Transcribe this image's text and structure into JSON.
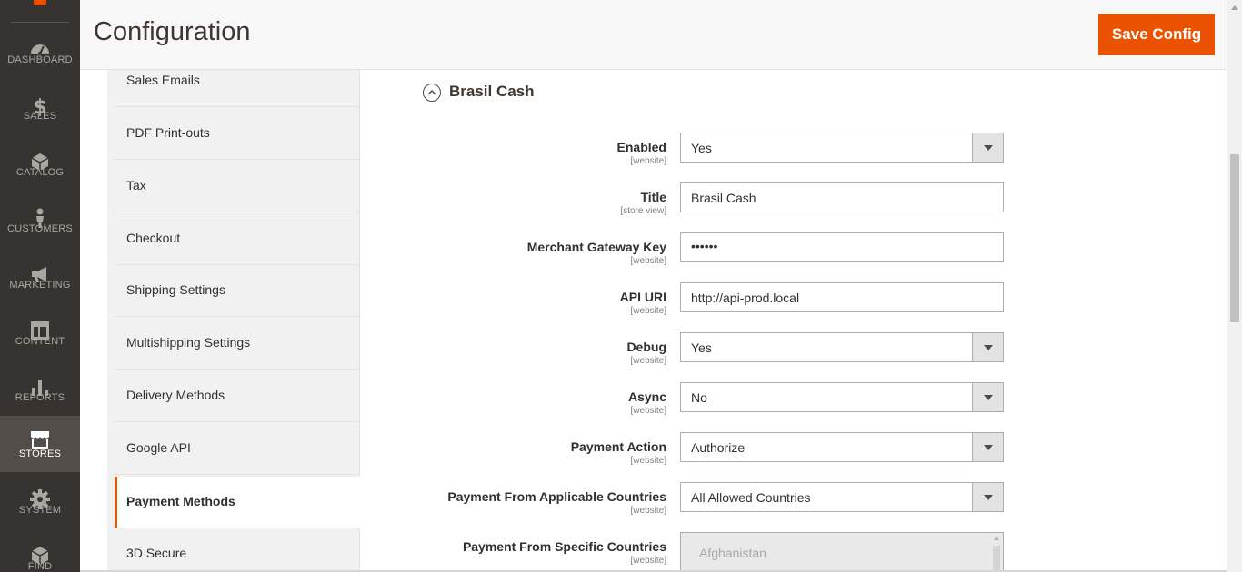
{
  "menu": {
    "items": [
      {
        "label": "DASHBOARD",
        "icon": "dashboard-icon"
      },
      {
        "label": "SALES",
        "icon": "dollar-icon"
      },
      {
        "label": "CATALOG",
        "icon": "box-icon"
      },
      {
        "label": "CUSTOMERS",
        "icon": "person-icon"
      },
      {
        "label": "MARKETING",
        "icon": "megaphone-icon"
      },
      {
        "label": "CONTENT",
        "icon": "layout-icon"
      },
      {
        "label": "REPORTS",
        "icon": "bar-chart-icon"
      },
      {
        "label": "STORES",
        "icon": "storefront-icon",
        "active": true
      },
      {
        "label": "SYSTEM",
        "icon": "gear-icon"
      },
      {
        "label": "FIND PARTNERS",
        "icon": "cube-icon"
      }
    ]
  },
  "header": {
    "title": "Configuration",
    "save_label": "Save Config"
  },
  "tabs": [
    {
      "label": "Sales Emails"
    },
    {
      "label": "PDF Print-outs"
    },
    {
      "label": "Tax"
    },
    {
      "label": "Checkout"
    },
    {
      "label": "Shipping Settings"
    },
    {
      "label": "Multishipping Settings"
    },
    {
      "label": "Delivery Methods"
    },
    {
      "label": "Google API"
    },
    {
      "label": "Payment Methods",
      "active": true
    },
    {
      "label": "3D Secure"
    }
  ],
  "section": {
    "title": "Brasil Cash",
    "fields": [
      {
        "label": "Enabled",
        "scope": "[website]",
        "type": "select",
        "value": "Yes"
      },
      {
        "label": "Title",
        "scope": "[store view]",
        "type": "text",
        "value": "Brasil Cash"
      },
      {
        "label": "Merchant Gateway Key",
        "scope": "[website]",
        "type": "password",
        "value": "••••••"
      },
      {
        "label": "API URI",
        "scope": "[website]",
        "type": "text",
        "value": "http://api-prod.local"
      },
      {
        "label": "Debug",
        "scope": "[website]",
        "type": "select",
        "value": "Yes"
      },
      {
        "label": "Async",
        "scope": "[website]",
        "type": "select",
        "value": "No"
      },
      {
        "label": "Payment Action",
        "scope": "[website]",
        "type": "select",
        "value": "Authorize"
      },
      {
        "label": "Payment From Applicable Countries",
        "scope": "[website]",
        "type": "select",
        "value": "All Allowed Countries"
      },
      {
        "label": "Payment From Specific Countries",
        "scope": "[website]",
        "type": "multiselect",
        "value": "Afghanistan"
      }
    ]
  },
  "colors": {
    "accent": "#eb5202",
    "menu_bg": "#373330",
    "menu_active_bg": "#524d49"
  }
}
